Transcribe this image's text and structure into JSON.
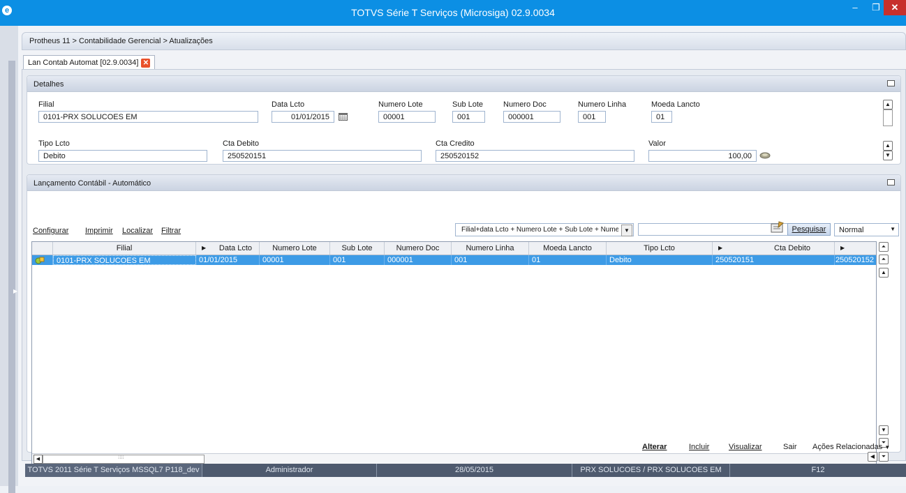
{
  "window": {
    "title": "TOTVS Série T Serviços (Microsiga) 02.9.0034"
  },
  "breadcrumb": "Protheus 11 > Contabilidade Gerencial > Atualizações",
  "tab": {
    "label": "Lan Contab Automat [02.9.0034]"
  },
  "detalhes": {
    "title": "Detalhes",
    "filial": {
      "label": "Filial",
      "value": "0101-PRX SOLUCOES EM"
    },
    "data_lcto": {
      "label": "Data Lcto",
      "value": "01/01/2015"
    },
    "numero_lote": {
      "label": "Numero Lote",
      "value": "00001"
    },
    "sub_lote": {
      "label": "Sub Lote",
      "value": "001"
    },
    "numero_doc": {
      "label": "Numero Doc",
      "value": "000001"
    },
    "numero_linha": {
      "label": "Numero Linha",
      "value": "001"
    },
    "moeda_lancto": {
      "label": "Moeda Lancto",
      "value": "01"
    },
    "tipo_lcto": {
      "label": "Tipo Lcto",
      "value": "Debito"
    },
    "cta_debito": {
      "label": "Cta Debito",
      "value": "250520151"
    },
    "cta_credito": {
      "label": "Cta Credito",
      "value": "250520152"
    },
    "valor": {
      "label": "Valor",
      "value": "100,00"
    }
  },
  "lancamento": {
    "title": "Lançamento Contábil - Automático",
    "links": {
      "configurar": "Configurar",
      "imprimir": "Imprimir",
      "localizar": "Localizar",
      "filtrar": "Filtrar"
    },
    "index_select": "Filial+data Lcto + Numero Lote + Sub Lote + Nume",
    "search_value": "",
    "search_button": "Pesquisar",
    "mode_select": "Normal",
    "columns": [
      "Filial",
      "Data Lcto",
      "Numero Lote",
      "Sub Lote",
      "Numero Doc",
      "Numero Linha",
      "Moeda Lancto",
      "Tipo Lcto",
      "Cta Debito",
      ""
    ],
    "rows": [
      [
        "0101-PRX SOLUCOES EM",
        "01/01/2015",
        "00001",
        "001",
        "000001",
        "001",
        "01",
        "Debito",
        "250520151",
        "250520152"
      ]
    ]
  },
  "actions": {
    "alterar": "Alterar",
    "incluir": "Incluir",
    "visualizar": "Visualizar",
    "sair": "Sair",
    "acoes": "Ações Relacionadas"
  },
  "status": {
    "system": "TOTVS 2011 Série T Serviços MSSQL7 P118_dev",
    "user": "Administrador",
    "date": "28/05/2015",
    "company": "PRX SOLUCOES / PRX SOLUCOES EM",
    "key": "F12"
  }
}
